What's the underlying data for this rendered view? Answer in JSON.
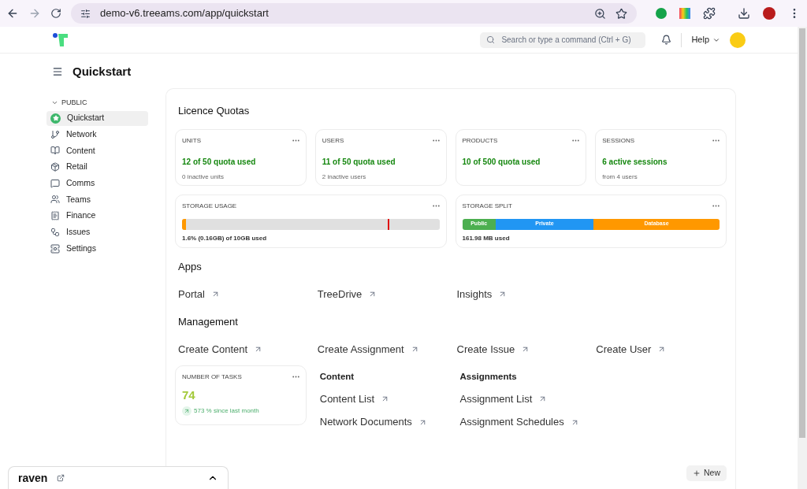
{
  "browser": {
    "url": "demo-v6.treeams.com/app/quickstart",
    "forward_disabled": true
  },
  "header": {
    "search": {
      "placeholder": "Search or type a command (Ctrl + G)"
    },
    "help": "Help"
  },
  "page": {
    "title": "Quickstart"
  },
  "sidebar": {
    "section": "PUBLIC",
    "expanded": true,
    "items": [
      {
        "label": "Quickstart",
        "selected": true
      },
      {
        "label": "Network",
        "selected": false
      },
      {
        "label": "Content",
        "selected": false
      },
      {
        "label": "Retail",
        "selected": false
      },
      {
        "label": "Comms",
        "selected": false
      },
      {
        "label": "Teams",
        "selected": false
      },
      {
        "label": "Finance",
        "selected": false
      },
      {
        "label": "Issues",
        "selected": false
      },
      {
        "label": "Settings",
        "selected": false
      }
    ]
  },
  "licence_quotas": {
    "title": "Licence Quotas",
    "cards": [
      {
        "title": "UNITS",
        "value": "12 of 50 quota used",
        "note": "0 inactive units"
      },
      {
        "title": "USERS",
        "value": "11 of 50 quota used",
        "note": "2 inactive users"
      },
      {
        "title": "PRODUCTS",
        "value": "10 of 500 quota used"
      },
      {
        "title": "SESSIONS",
        "value": "6 active sessions",
        "note": "from 4 users"
      }
    ]
  },
  "storage_usage": {
    "title": "STORAGE USAGE",
    "level": 0.016,
    "limit_marker": {
      "level": 0.8
    },
    "reading": "1.6% (0.16GB) of 10GB used"
  },
  "storage_split": {
    "title": "STORAGE SPLIT",
    "segments": [
      {
        "label": "Public",
        "color": "#4caf50"
      },
      {
        "label": "Private",
        "color": "#2196f3"
      },
      {
        "label": "Database",
        "color": "#ff9800"
      }
    ],
    "reading": "161.98 MB used"
  },
  "apps": {
    "title": "Apps",
    "links": [
      "Portal",
      "TreeDrive",
      "Insights"
    ]
  },
  "management": {
    "title": "Management",
    "links": [
      "Create Content",
      "Create Assignment",
      "Create Issue",
      "Create User"
    ]
  },
  "tasks_card": {
    "title": "NUMBER OF TASKS",
    "value": "74",
    "trend": "573 % since last month"
  },
  "content": {
    "title": "Content",
    "links": [
      "Content List",
      "Network Documents"
    ]
  },
  "assignments": {
    "title": "Assignments",
    "links": [
      "Assignment List",
      "Assignment Schedules"
    ]
  },
  "new_button": "New",
  "footer_widget": {
    "title": "raven",
    "expanded": false
  }
}
